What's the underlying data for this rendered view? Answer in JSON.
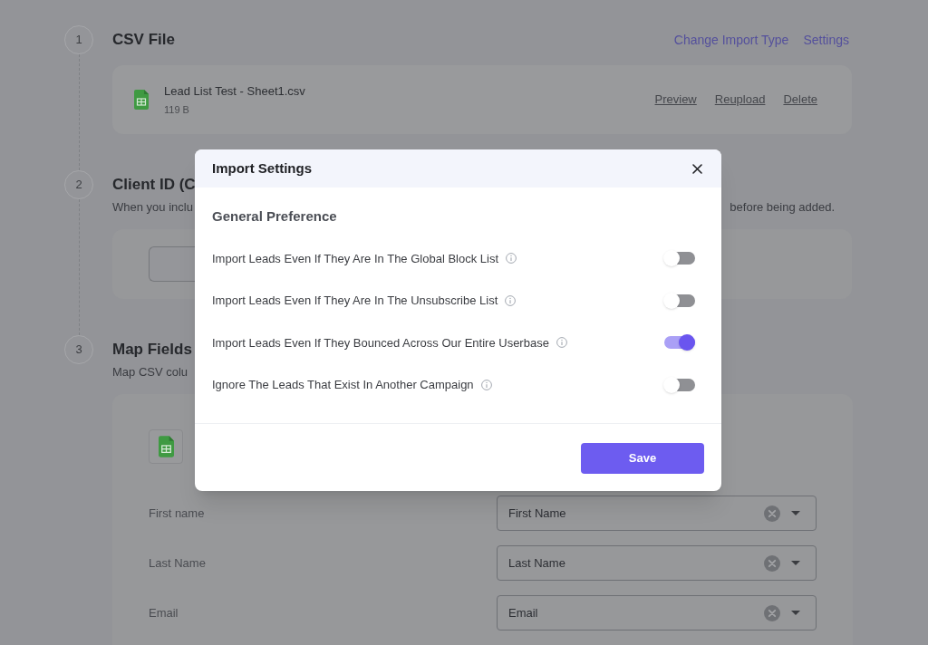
{
  "steps": [
    {
      "number": "1",
      "kind": "file",
      "title": "CSV File",
      "links": [
        "Change Import Type",
        "Settings"
      ],
      "file": {
        "name": "Lead List Test - Sheet1.csv",
        "size": "119 B",
        "actions": [
          "Preview",
          "Reupload",
          "Delete"
        ]
      }
    },
    {
      "number": "2",
      "kind": "input",
      "title": "Client ID (C",
      "description": "When you inclu",
      "description_end": "before being added."
    },
    {
      "number": "3",
      "kind": "mapping",
      "title": "Map Fields",
      "description": "Map CSV colu",
      "mappings": [
        {
          "field": "First name",
          "value": "First Name"
        },
        {
          "field": "Last Name",
          "value": "Last Name"
        },
        {
          "field": "Email",
          "value": "Email"
        }
      ]
    }
  ],
  "dialog": {
    "title": "Import Settings",
    "section": "General Preference",
    "options": [
      {
        "label": "Import Leads Even If They Are In The Global Block List",
        "on": false
      },
      {
        "label": "Import Leads Even If They Are In The Unsubscribe List",
        "on": false
      },
      {
        "label": "Import Leads Even If They Bounced Across Our Entire Userbase",
        "on": true
      },
      {
        "label": "Ignore The Leads That Exist In Another Campaign",
        "on": false
      }
    ],
    "buttons": [
      "Save"
    ]
  }
}
